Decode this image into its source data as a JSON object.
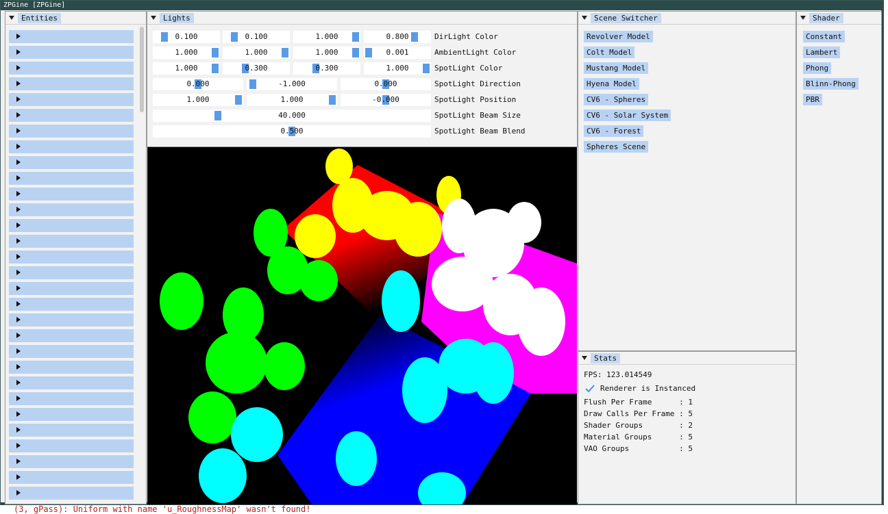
{
  "window": {
    "title": "ZPGine [ZPGine]"
  },
  "entities": {
    "title": "Entities",
    "row_count": 30
  },
  "lights": {
    "title": "Lights",
    "rows": [
      {
        "label": "DirLight Color",
        "values": [
          "0.100",
          "0.100",
          "1.000",
          "0.800"
        ]
      },
      {
        "label": "AmbientLight Color",
        "values": [
          "1.000",
          "1.000",
          "1.000",
          "0.001"
        ]
      },
      {
        "label": "SpotLight Color",
        "values": [
          "1.000",
          "0.300",
          "0.300",
          "1.000"
        ]
      },
      {
        "label": "SpotLight Direction",
        "values": [
          "0.000",
          "-1.000",
          "0.000"
        ]
      },
      {
        "label": "SpotLight Position",
        "values": [
          "1.000",
          "1.000",
          "-0.000"
        ]
      },
      {
        "label": "SpotLight Beam Size",
        "values": [
          "40.000"
        ]
      },
      {
        "label": "SpotLight Beam Blend",
        "values": [
          "0.500"
        ]
      }
    ]
  },
  "scene_switcher": {
    "title": "Scene Switcher",
    "items": [
      "Revolver Model",
      "Colt Model",
      "Mustang Model",
      "Hyena Model",
      "CV6 - Spheres",
      "CV6 - Solar System",
      "CV6 - Forest",
      "Spheres Scene"
    ]
  },
  "shader": {
    "title": "Shader",
    "items": [
      "Constant",
      "Lambert",
      "Phong",
      "Blinn-Phong",
      "PBR"
    ]
  },
  "stats": {
    "title": "Stats",
    "fps": "FPS: 123.014549",
    "instanced_label": "Renderer is Instanced",
    "lines": [
      "Flush Per Frame      : 1",
      "Draw Calls Per Frame : 5",
      "Shader Groups        : 2",
      "Material Groups      : 5",
      "VAO Groups           : 5"
    ]
  },
  "console": {
    "text": "(3, gPass): Uniform with name 'u_RoughnessMap' wasn't found!"
  },
  "colors": {
    "accent": "#b9d2f2",
    "grab": "#5a9be8",
    "titlebar": "#2b4b4b"
  }
}
